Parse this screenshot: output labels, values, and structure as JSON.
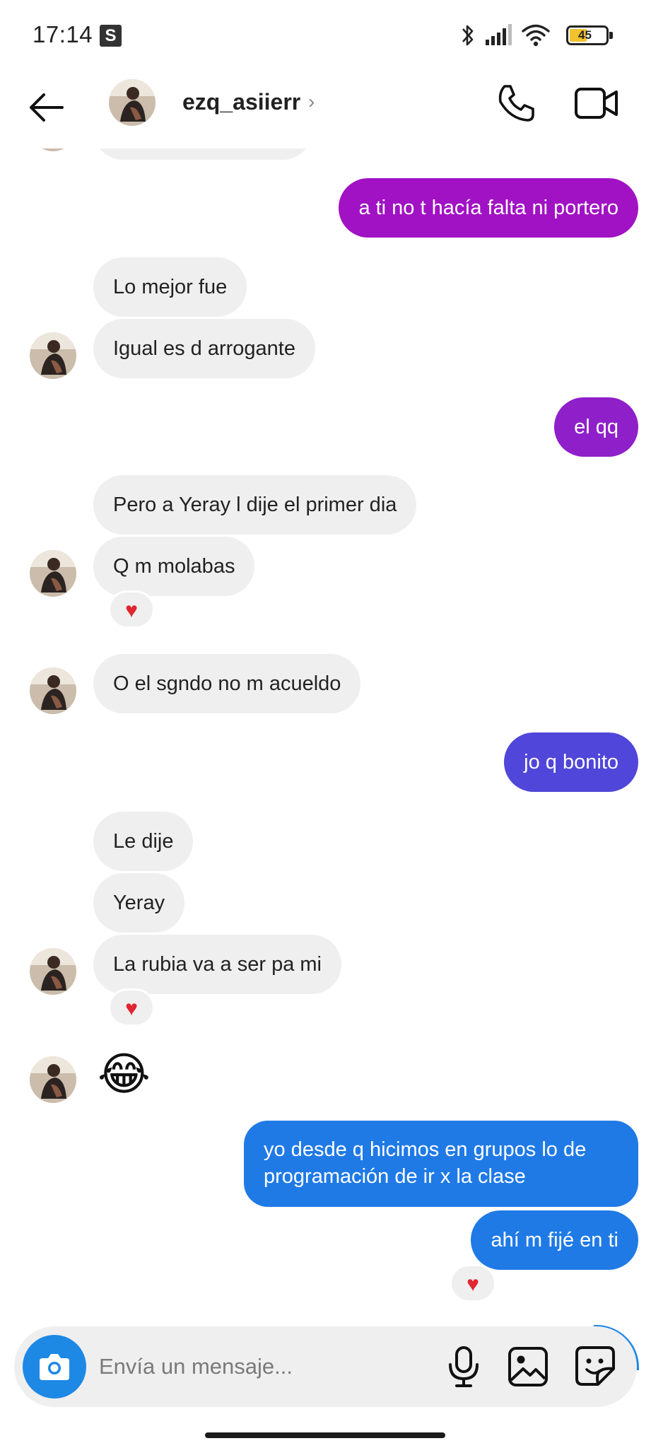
{
  "status_bar": {
    "time": "17:14",
    "s_badge": "S",
    "battery": "45",
    "icons": [
      "bluetooth-icon",
      "signal-icon",
      "wifi-icon",
      "battery-icon"
    ]
  },
  "header": {
    "username": "ezq_asiierr",
    "chevron": "›",
    "icons": [
      "back-arrow-icon",
      "phone-icon",
      "video-camera-icon"
    ]
  },
  "messages": [
    {
      "side": "out",
      "text": "a ti no t hacía falta ni portero",
      "color": "#a112c4"
    },
    {
      "side": "in",
      "text": "Lo mejor fue"
    },
    {
      "side": "in",
      "text": "Igual es d arrogante"
    },
    {
      "side": "out",
      "text": "el qq",
      "color": "#8f1fc9"
    },
    {
      "side": "in",
      "text": "Pero a Yeray l dije el primer dia"
    },
    {
      "side": "in",
      "text": "Q m molabas",
      "reaction": "♥"
    },
    {
      "side": "in",
      "text": "O el sgndo no m acueldo"
    },
    {
      "side": "out",
      "text": "jo q bonito",
      "color": "#5046d9"
    },
    {
      "side": "in",
      "text": "Le dije"
    },
    {
      "side": "in",
      "text": "Yeray"
    },
    {
      "side": "in",
      "text": "La rubia va a ser pa mi",
      "reaction": "♥"
    },
    {
      "side": "in",
      "text": "😂",
      "emoji": true
    },
    {
      "side": "out",
      "text": "yo desde q hicimos en grupos lo de programación de ir x la clase",
      "color": "#1f7ae6"
    },
    {
      "side": "out",
      "text": "ahí m fijé en ti",
      "color": "#1f7ae6",
      "reaction": "♥"
    }
  ],
  "composer": {
    "placeholder": "Envía un mensaje...",
    "icons": [
      "camera-icon",
      "microphone-icon",
      "gallery-icon",
      "sticker-icon"
    ],
    "accent_color": "#1e88e5"
  }
}
